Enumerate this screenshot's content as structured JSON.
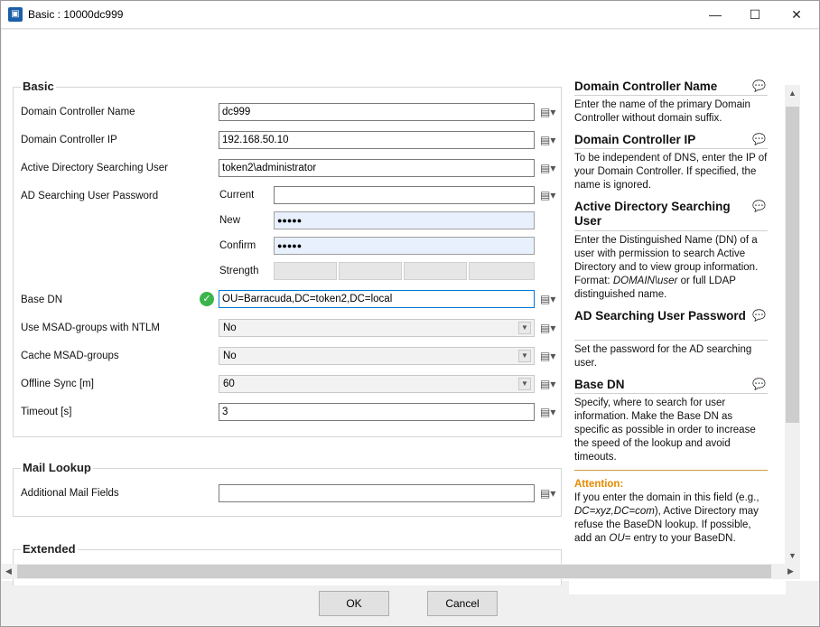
{
  "window": {
    "title": "Basic : 10000dc999",
    "minimize_glyph": "—",
    "maximize_glyph": "☐",
    "close_glyph": "✕"
  },
  "basic": {
    "group_title": "Basic",
    "domain_controller_name": {
      "label": "Domain Controller Name",
      "value": "dc999"
    },
    "domain_controller_ip": {
      "label": "Domain Controller IP",
      "value": "192.168.50.10"
    },
    "ad_searching_user": {
      "label": "Active Directory Searching User",
      "value": "token2\\administrator"
    },
    "ad_searching_password": {
      "label": "AD Searching User Password",
      "current_label": "Current",
      "current_value": "",
      "new_label": "New",
      "new_value": "●●●●●",
      "confirm_label": "Confirm",
      "confirm_value": "●●●●●",
      "strength_label": "Strength"
    },
    "base_dn": {
      "label": "Base DN",
      "value": "OU=Barracuda,DC=token2,DC=local"
    },
    "use_msad_groups_ntlm": {
      "label": "Use MSAD-groups with NTLM",
      "value": "No"
    },
    "cache_msad_groups": {
      "label": "Cache MSAD-groups",
      "value": "No"
    },
    "offline_sync": {
      "label": "Offline Sync [m]",
      "value": "60"
    },
    "timeout": {
      "label": "Timeout [s]",
      "value": "3"
    }
  },
  "mail_lookup": {
    "group_title": "Mail Lookup",
    "additional_mail_fields": {
      "label": "Additional Mail Fields",
      "value": ""
    }
  },
  "extended": {
    "group_title": "Extended"
  },
  "help": {
    "dc_name_title": "Domain Controller Name",
    "dc_name_text": "Enter the name of the primary Domain Controller without domain suffix.",
    "dc_ip_title": "Domain Controller IP",
    "dc_ip_text": "To be independent of DNS, enter the IP of your Domain Controller. If specified, the name is ignored.",
    "ad_user_title": "Active Directory Searching User",
    "ad_user_text_1": "Enter the Distinguished Name (DN) of a user with permission to search Active Directory and to view group information. Format: ",
    "ad_user_format": "DOMAIN\\user",
    "ad_user_text_2": " or full LDAP distinguished name.",
    "ad_pass_title": "AD Searching User Password",
    "ad_pass_text": "Set the password for the AD searching user.",
    "base_dn_title": "Base DN",
    "base_dn_text": "Specify, where to search for user information. Make the Base DN as specific as possible in order to increase the speed of the lookup and avoid timeouts.",
    "attention_label": "Attention:",
    "attention_text_1": "If you enter the domain in this field (e.g., ",
    "attention_example": "DC=xyz,DC=com",
    "attention_text_2": "), Active Directory may refuse the BaseDN lookup. If possible, add an ",
    "attention_ou": "OU=",
    "attention_text_3": " entry to your BaseDN."
  },
  "buttons": {
    "ok": "OK",
    "cancel": "Cancel"
  }
}
